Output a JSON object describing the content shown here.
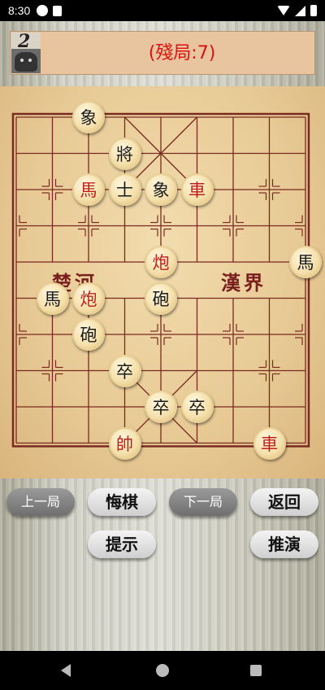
{
  "status": {
    "time": "8:30"
  },
  "header": {
    "level_number": "2",
    "title": "(殘局:7)"
  },
  "board": {
    "river_left": "楚河",
    "river_right": "漢界",
    "pieces": [
      {
        "char": "象",
        "color": "black",
        "col": 2,
        "row": 0
      },
      {
        "char": "將",
        "color": "black",
        "col": 3,
        "row": 1
      },
      {
        "char": "馬",
        "color": "red",
        "col": 2,
        "row": 2
      },
      {
        "char": "士",
        "color": "black",
        "col": 3,
        "row": 2
      },
      {
        "char": "象",
        "color": "black",
        "col": 4,
        "row": 2
      },
      {
        "char": "車",
        "color": "red",
        "col": 5,
        "row": 2
      },
      {
        "char": "炮",
        "color": "red",
        "col": 4,
        "row": 4
      },
      {
        "char": "馬",
        "color": "black",
        "col": 8,
        "row": 4
      },
      {
        "char": "馬",
        "color": "black",
        "col": 1,
        "row": 5
      },
      {
        "char": "炮",
        "color": "red",
        "col": 2,
        "row": 5
      },
      {
        "char": "砲",
        "color": "black",
        "col": 4,
        "row": 5
      },
      {
        "char": "砲",
        "color": "black",
        "col": 2,
        "row": 6
      },
      {
        "char": "卒",
        "color": "black",
        "col": 3,
        "row": 7
      },
      {
        "char": "卒",
        "color": "black",
        "col": 4,
        "row": 8
      },
      {
        "char": "卒",
        "color": "black",
        "col": 5,
        "row": 8
      },
      {
        "char": "帥",
        "color": "red",
        "col": 3,
        "row": 9
      },
      {
        "char": "車",
        "color": "red",
        "col": 7,
        "row": 9
      }
    ]
  },
  "buttons": {
    "prev_game": "上一局",
    "undo": "悔棋",
    "next_game": "下一局",
    "back": "返回",
    "hint": "提示",
    "deduce": "推演"
  }
}
